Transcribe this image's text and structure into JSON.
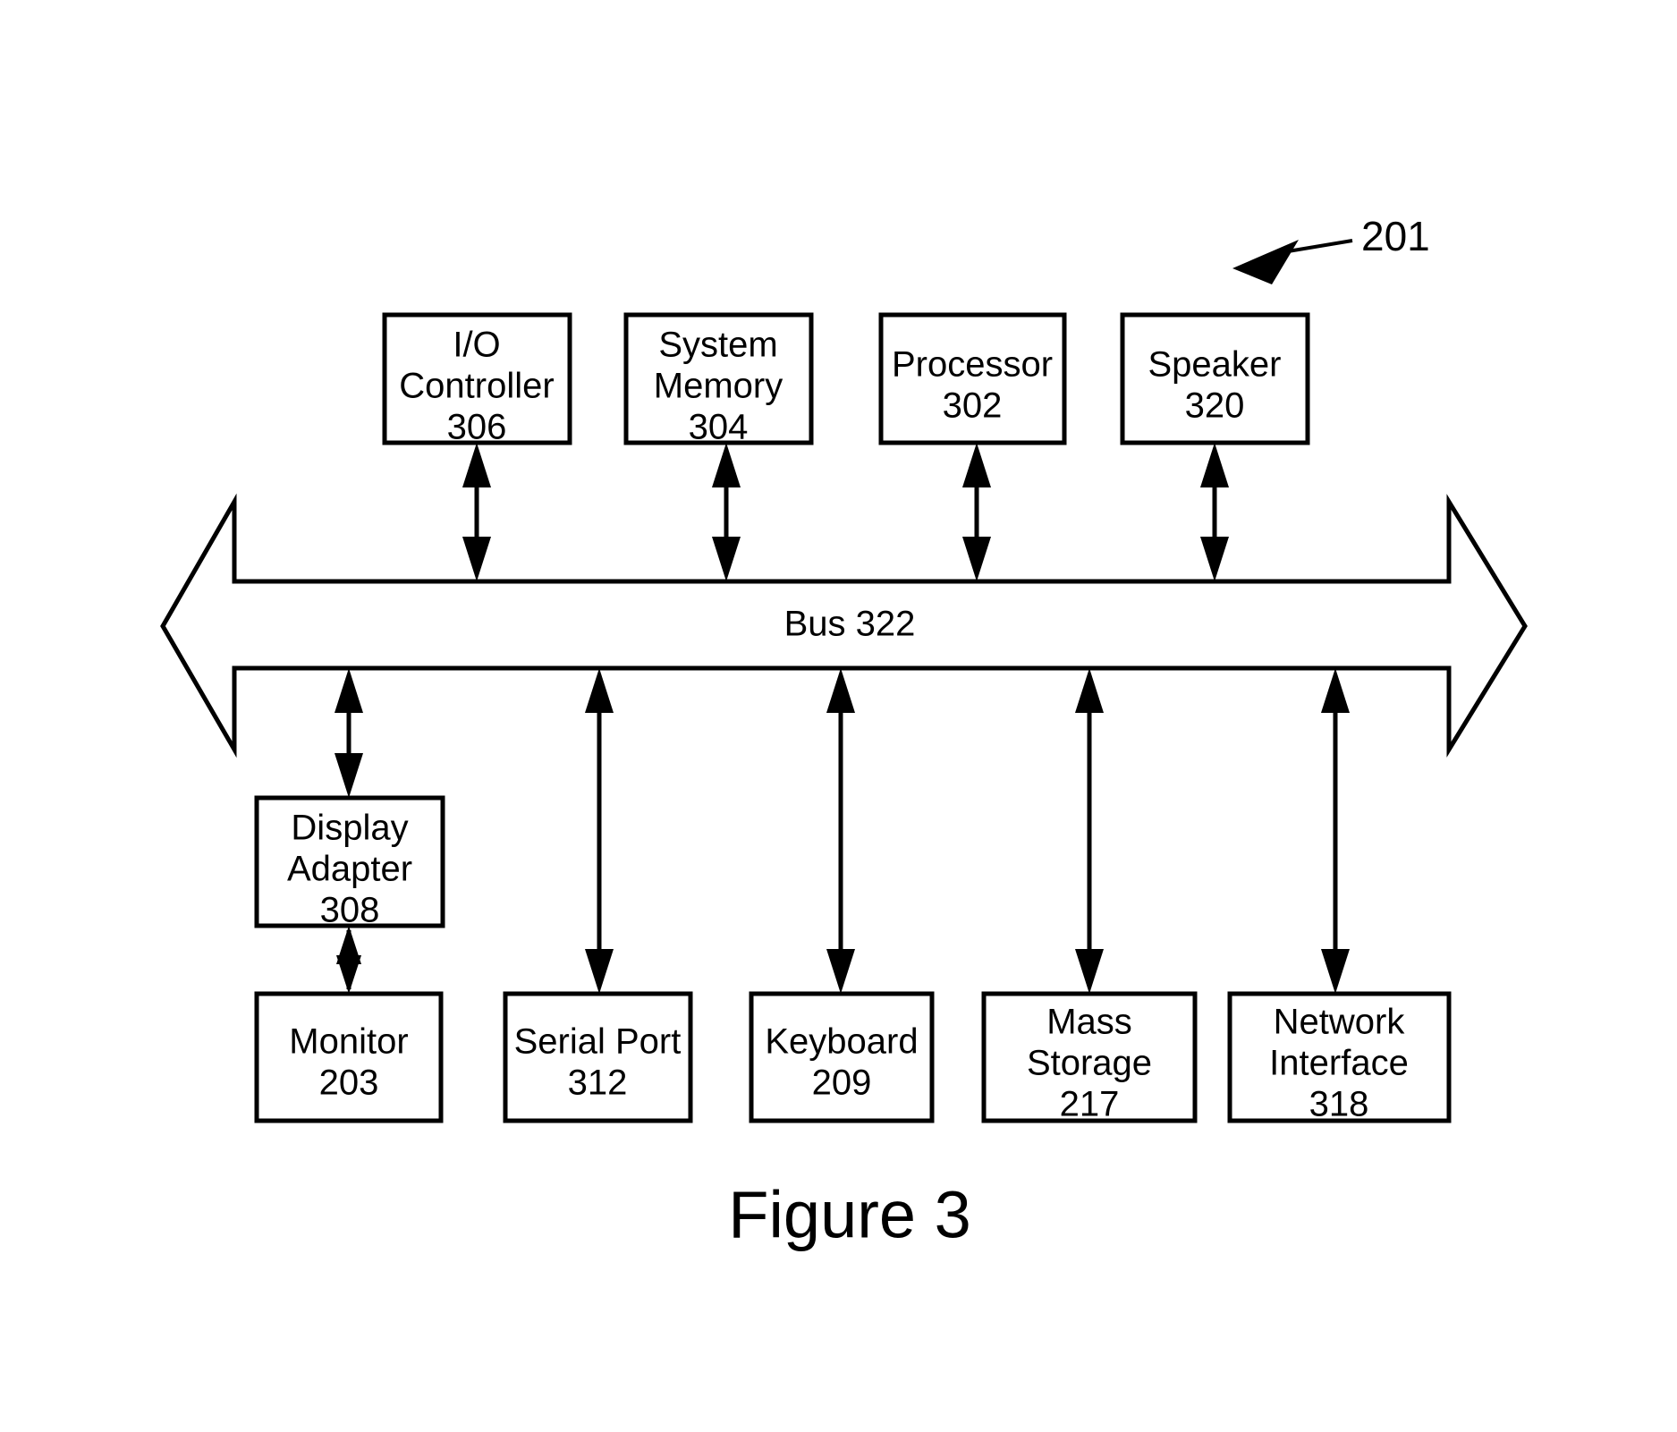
{
  "figure": {
    "caption": "Figure 3",
    "system_reference_label": "201",
    "bus": {
      "label": "Bus 322",
      "name": "Bus",
      "number": "322"
    },
    "top_row_boxes": [
      {
        "id": "io-controller",
        "line1": "I/O",
        "line2": "Controller",
        "number": "306"
      },
      {
        "id": "system-memory",
        "line1": "System",
        "line2": "Memory",
        "number": "304"
      },
      {
        "id": "processor",
        "line1": "Processor",
        "line2": "",
        "number": "302"
      },
      {
        "id": "speaker",
        "line1": "Speaker",
        "line2": "",
        "number": "320"
      }
    ],
    "middle_row_boxes": [
      {
        "id": "display-adapter",
        "line1": "Display",
        "line2": "Adapter",
        "number": "308"
      }
    ],
    "bottom_row_boxes": [
      {
        "id": "monitor",
        "line1": "Monitor",
        "line2": "",
        "number": "203"
      },
      {
        "id": "serial-port",
        "line1": "Serial Port",
        "line2": "",
        "number": "312"
      },
      {
        "id": "keyboard",
        "line1": "Keyboard",
        "line2": "",
        "number": "209"
      },
      {
        "id": "mass-storage",
        "line1": "Mass",
        "line2": "Storage",
        "number": "217"
      },
      {
        "id": "network-interface",
        "line1": "Network",
        "line2": "Interface",
        "number": "318"
      }
    ],
    "colors": {
      "background": "#ffffff",
      "stroke": "#000000",
      "text": "#000000"
    }
  }
}
